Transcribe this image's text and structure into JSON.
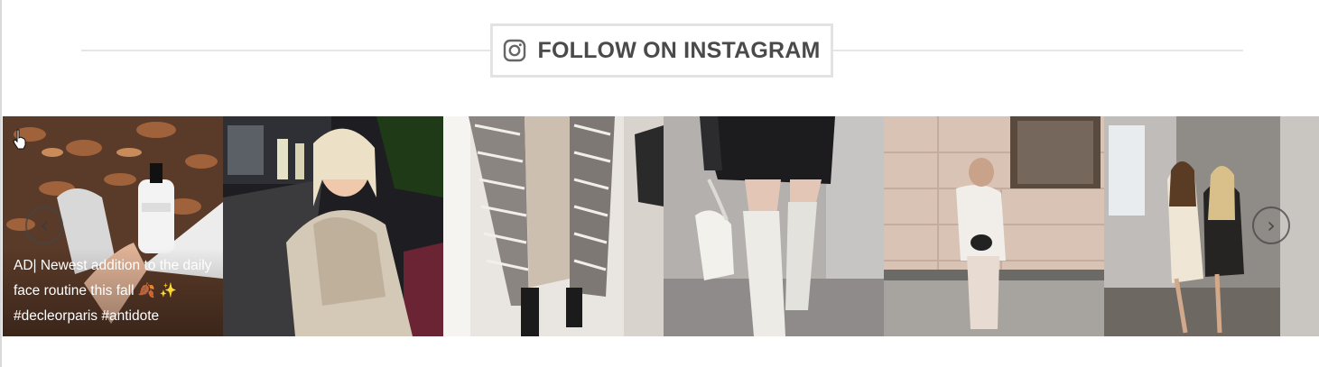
{
  "header": {
    "title": "FOLLOW ON INSTAGRAM",
    "icon": "instagram-icon"
  },
  "feed": {
    "posts": [
      {
        "alt": "Autumn leaves with hand holding serum bottle",
        "caption": "AD| Newest addition to the daily face routine this fall 🍂 ✨ #decleorparis #antidote"
      },
      {
        "alt": "Woman in fur coat on city street at night",
        "caption": ""
      },
      {
        "alt": "Houndstooth coat mirror selfie",
        "caption": ""
      },
      {
        "alt": "White knee-high boots and black skirt",
        "caption": ""
      },
      {
        "alt": "Woman in white jacket by stone building",
        "caption": ""
      },
      {
        "alt": "Two women posing indoors",
        "caption": ""
      }
    ]
  },
  "nav": {
    "prev_icon": "chevron-left-icon",
    "next_icon": "chevron-right-icon",
    "prev_glyph": "‹",
    "next_glyph": "›"
  }
}
